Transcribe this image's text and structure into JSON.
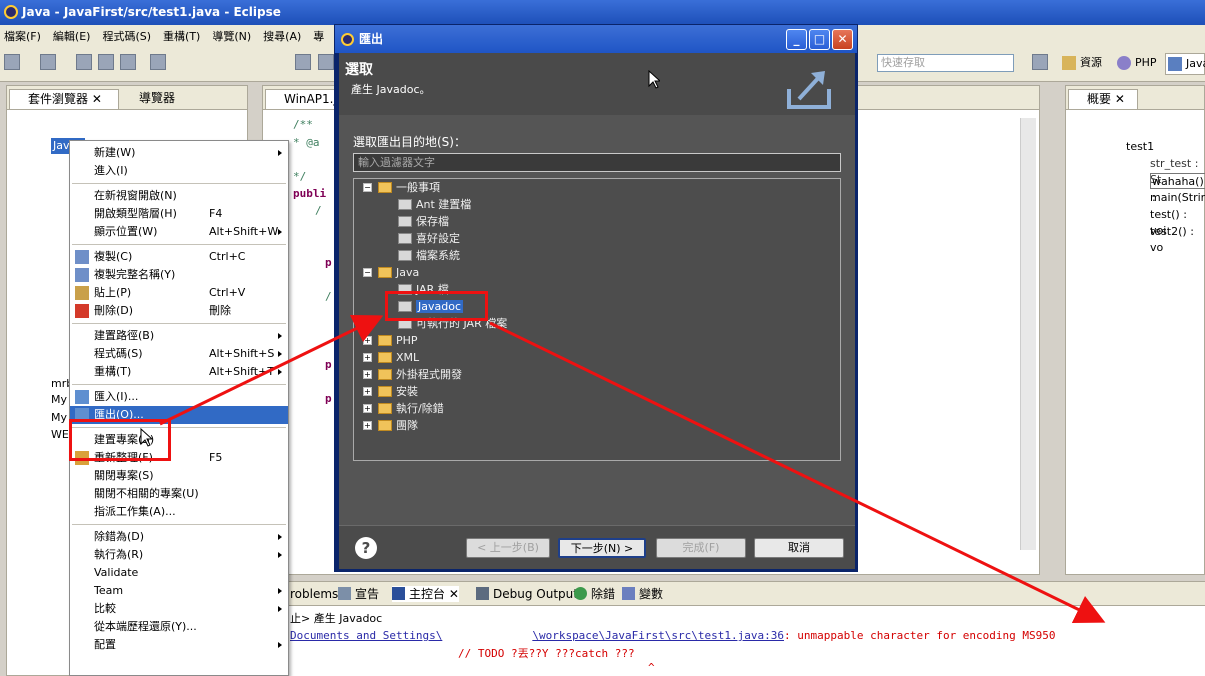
{
  "window": {
    "title": "Java - JavaFirst/src/test1.java - Eclipse"
  },
  "menubar": [
    "檔案(F)",
    "編輯(E)",
    "程式碼(S)",
    "重構(T)",
    "導覽(N)",
    "搜尋(A)",
    "專"
  ],
  "toolbar": {
    "quick_access_placeholder": "快速存取",
    "perspectives": [
      "資源",
      "PHP",
      "Java"
    ]
  },
  "left_pane": {
    "tabs": [
      "套件瀏覽器",
      "導覽器"
    ],
    "tree": [
      "JavaF",
      "mrb",
      "My",
      "My",
      "WE"
    ]
  },
  "editor": {
    "tab": "WinAP1.java",
    "lines": [
      "/**",
      " * @a",
      " */",
      "publi",
      "   /",
      "p",
      "/",
      "p",
      "p"
    ]
  },
  "outline": {
    "tab": "概要",
    "root": "test1",
    "items": [
      "str_test : St",
      "wahaha() : ",
      "main(String",
      "test() : voi",
      "test2() : vo"
    ]
  },
  "context_menu": {
    "items": [
      {
        "label": "新建(W)",
        "accel": "",
        "submenu": true
      },
      {
        "label": "進入(I)",
        "accel": "",
        "submenu": false
      },
      {
        "sep": true
      },
      {
        "label": "在新視窗開啟(N)",
        "accel": "",
        "submenu": false
      },
      {
        "label": "開啟類型階層(H)",
        "accel": "F4",
        "submenu": false
      },
      {
        "label": "顯示位置(W)",
        "accel": "Alt+Shift+W",
        "submenu": true
      },
      {
        "sep": true
      },
      {
        "label": "複製(C)",
        "accel": "Ctrl+C",
        "submenu": false
      },
      {
        "label": "複製完整名稱(Y)",
        "accel": "",
        "submenu": false
      },
      {
        "label": "貼上(P)",
        "accel": "Ctrl+V",
        "submenu": false
      },
      {
        "label": "刪除(D)",
        "accel": "刪除",
        "submenu": false
      },
      {
        "sep": true
      },
      {
        "label": "建置路徑(B)",
        "accel": "",
        "submenu": true
      },
      {
        "label": "程式碼(S)",
        "accel": "Alt+Shift+S",
        "submenu": true
      },
      {
        "label": "重構(T)",
        "accel": "Alt+Shift+T",
        "submenu": true
      },
      {
        "sep": true
      },
      {
        "label": "匯入(I)...",
        "accel": "",
        "submenu": false
      },
      {
        "label": "匯出(O)...",
        "accel": "",
        "submenu": false,
        "selected": true
      },
      {
        "sep": true
      },
      {
        "label": "建置專案(B)",
        "accel": "",
        "submenu": false
      },
      {
        "label": "重新整理(F)",
        "accel": "F5",
        "submenu": false
      },
      {
        "label": "關閉專案(S)",
        "accel": "",
        "submenu": false
      },
      {
        "label": "關閉不相關的專案(U)",
        "accel": "",
        "submenu": false
      },
      {
        "label": "指派工作集(A)...",
        "accel": "",
        "submenu": false
      },
      {
        "sep": true
      },
      {
        "label": "除錯為(D)",
        "accel": "",
        "submenu": true
      },
      {
        "label": "執行為(R)",
        "accel": "",
        "submenu": true
      },
      {
        "label": "Validate",
        "accel": "",
        "submenu": false
      },
      {
        "label": "Team",
        "accel": "",
        "submenu": true
      },
      {
        "label": "比較",
        "accel": "",
        "submenu": true
      },
      {
        "label": "從本端歷程還原(Y)...",
        "accel": "",
        "submenu": false
      },
      {
        "label": "配置",
        "accel": "",
        "submenu": true
      }
    ]
  },
  "dialog": {
    "title": "匯出",
    "header_title": "選取",
    "header_subtitle": "產生 Javadoc。",
    "dest_label": "選取匯出目的地(S)：",
    "filter_placeholder": "輸入過濾器文字",
    "tree": [
      {
        "label": "一般事項",
        "level": 0,
        "expanded": true
      },
      {
        "label": "Ant 建置檔",
        "level": 1
      },
      {
        "label": "保存檔",
        "level": 1
      },
      {
        "label": "喜好設定",
        "level": 1
      },
      {
        "label": "檔案系統",
        "level": 1
      },
      {
        "label": "Java",
        "level": 0,
        "expanded": true
      },
      {
        "label": "JAR 檔",
        "level": 1
      },
      {
        "label": "Javadoc",
        "level": 1,
        "selected": true
      },
      {
        "label": "可執行的 JAR 檔案",
        "level": 1
      },
      {
        "label": "PHP",
        "level": 0,
        "expanded": false
      },
      {
        "label": "XML",
        "level": 0,
        "expanded": false
      },
      {
        "label": "外掛程式開發",
        "level": 0,
        "expanded": false
      },
      {
        "label": "安裝",
        "level": 0,
        "expanded": false
      },
      {
        "label": "執行/除錯",
        "level": 0,
        "expanded": false
      },
      {
        "label": "團隊",
        "level": 0,
        "expanded": false
      }
    ],
    "buttons": {
      "back": "< 上一步(B)",
      "next": "下一步(N) >",
      "finish": "完成(F)",
      "cancel": "取消"
    }
  },
  "console": {
    "tabs": [
      "roblems",
      "宣告",
      "主控台",
      "Debug Output",
      "除錯",
      "變數"
    ],
    "status": "止> 產生 Javadoc",
    "line1_path": "Documents and Settings\\",
    "line1_path2": "\\workspace\\JavaFirst\\src\\test1.java:36",
    "line1_msg": ": unmappable character for encoding MS950",
    "line2": "// TODO ?丟??Y ???catch ???",
    "line3": "^"
  },
  "colors": {
    "accent": "#316ac5",
    "highlight": "#e11111",
    "console_error": "#d40000"
  }
}
